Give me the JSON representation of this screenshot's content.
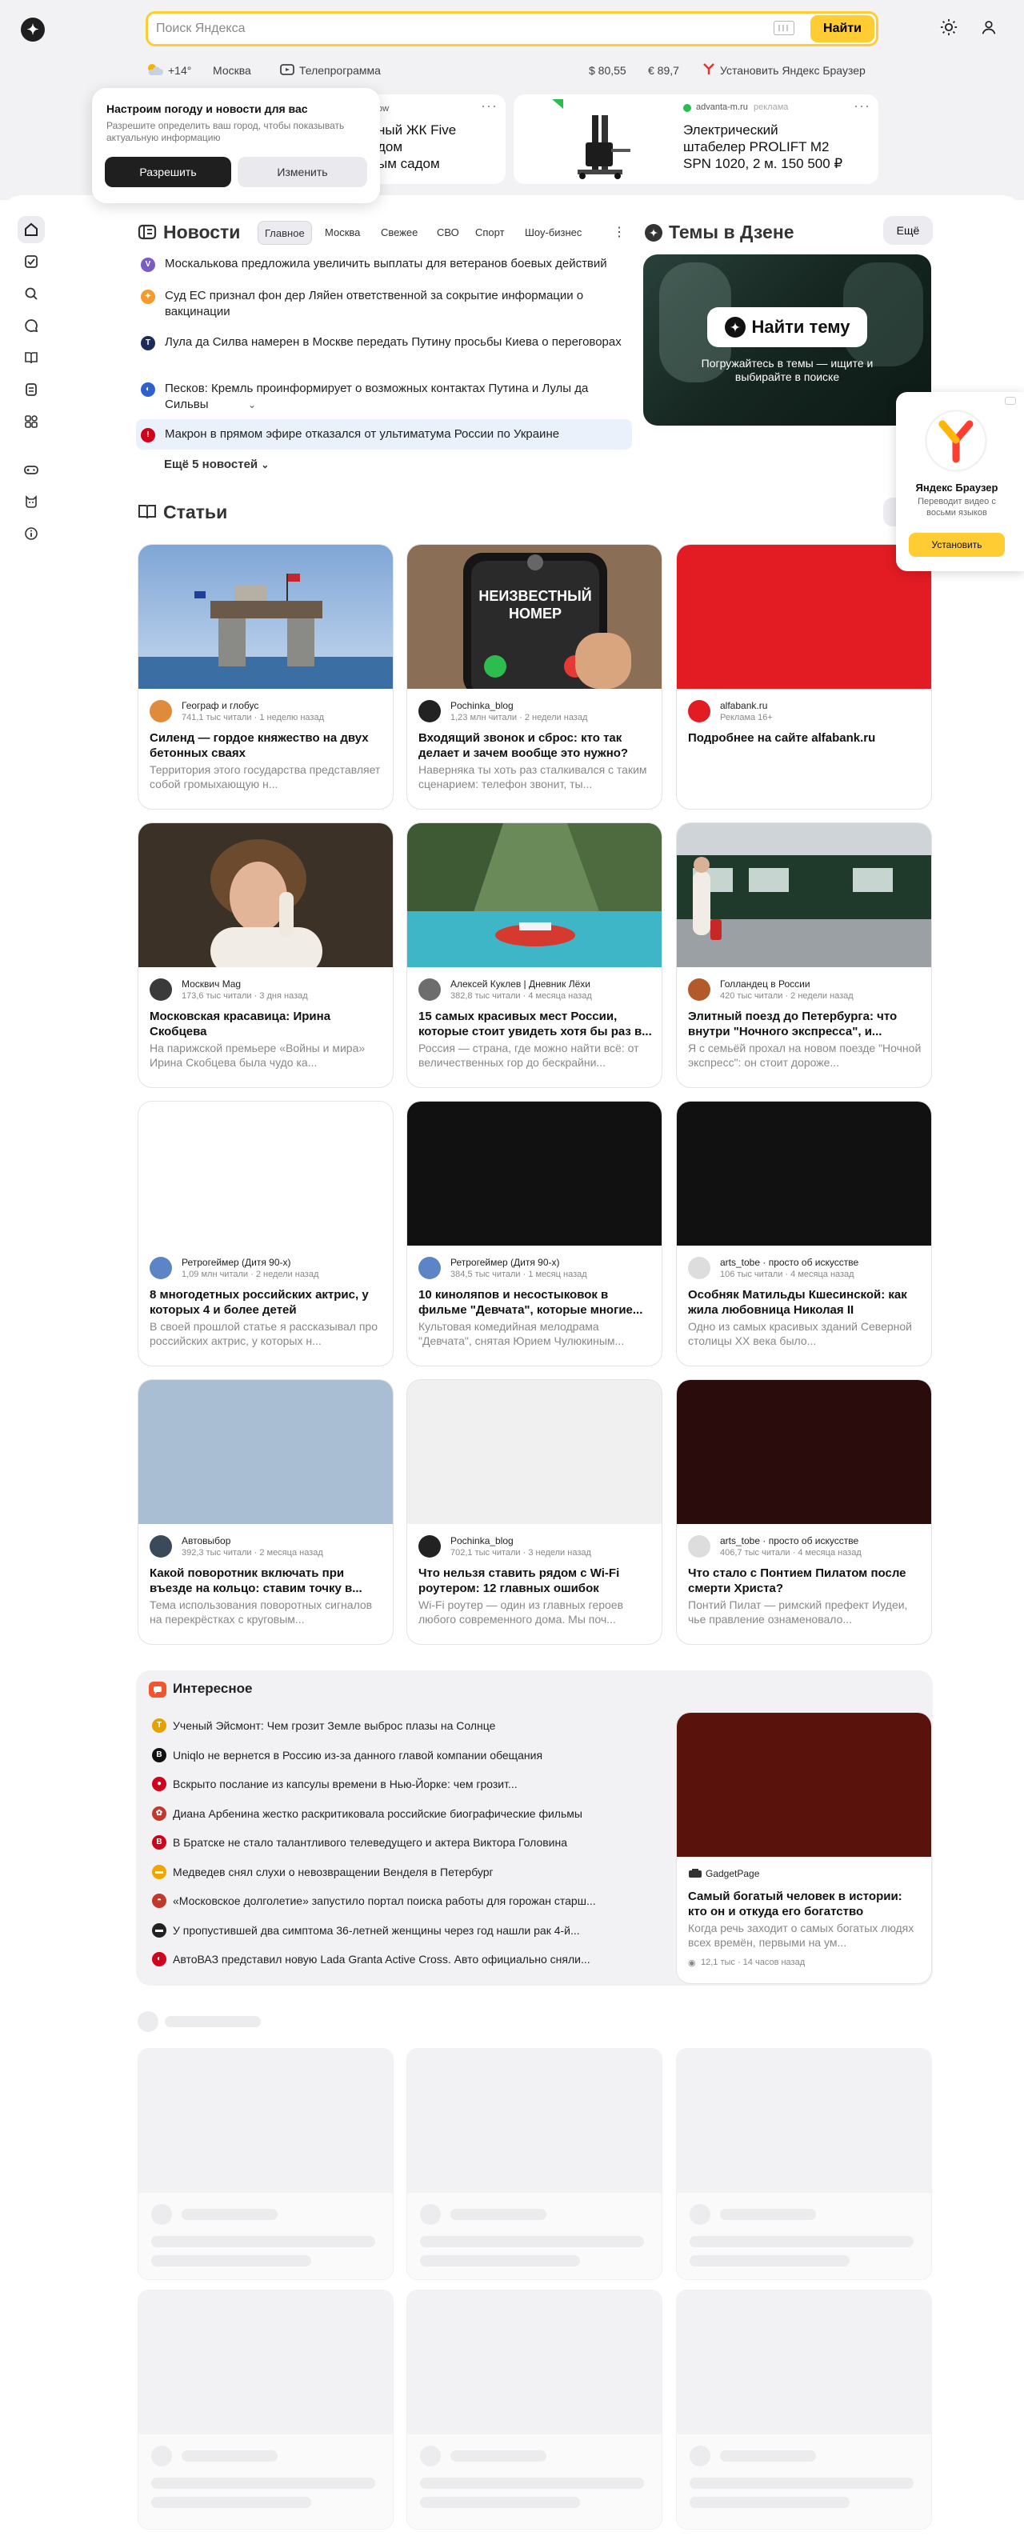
{
  "header": {
    "logo": "✦",
    "search_placeholder": "Поиск Яндекса",
    "search_button": "Найти",
    "icons": [
      "theme-sun-icon",
      "profile-icon"
    ]
  },
  "infobar": {
    "weather_temp": "+14°",
    "city": "Москва",
    "tv": "Телепрограмма",
    "usd": "$ 80,55",
    "eur": "€ 89,7",
    "install_browser": "Установить Яндекс Браузер"
  },
  "popup": {
    "title": "Настроим погоду и новости для вас",
    "desc": "Разрешите определить ваш город, чтобы показывать актуальную информацию",
    "allow": "Разрешить",
    "change": "Изменить"
  },
  "ads": [
    {
      "source": "ow",
      "title": "ный ЖК Five\nдом\nым садом",
      "more": "···"
    },
    {
      "source": "advanta-m.ru",
      "tag": "реклама",
      "title": "Электрический штабелер PROLIFT M2 SPN 1020, 2 м. 150 500 ₽",
      "more": "···"
    }
  ],
  "news": {
    "title": "Новости",
    "tabs": [
      "Главное",
      "Москва",
      "Свежее",
      "СВО",
      "Спорт",
      "Шоу-бизнес"
    ],
    "tabs_more": "⋮",
    "items": [
      {
        "text": "Москалькова предложила увеличить выплаты для ветеранов боевых действий",
        "color": "#7b5cc4",
        "glyph": "V"
      },
      {
        "text": "Суд ЕС признал фон дер Ляйен ответственной за сокрытие информации о вакцинации",
        "color": "#f59b2b",
        "glyph": "✦"
      },
      {
        "text": "Лула да Силва намерен в Москве передать Путину просьбы Киева о переговорах",
        "color": "#1d2a5c",
        "glyph": "Т"
      },
      {
        "text": "Песков: Кремль проинформирует о возможных контактах Путина и Лулы да Сильвы",
        "color": "#2f5fd0",
        "glyph": "◐"
      },
      {
        "text": "Макрон в прямом эфире отказался от ультиматума России по Украине",
        "color": "#d0021b",
        "glyph": "!"
      }
    ],
    "more": "Ещё 5 новостей"
  },
  "dzen": {
    "title": "Темы в Дзене",
    "more": "Ещё",
    "button": "Найти тему",
    "subtitle": "Погружайтесь в темы — ищите и выбирайте в поиске"
  },
  "promo": {
    "title": "Яндекс Браузер",
    "desc": "Переводит видео с восьми языков",
    "button": "Установить"
  },
  "articles": {
    "title": "Статьи",
    "cards": [
      {
        "author": "Географ и глобус",
        "meta": "741,1 тыс читали · 1 неделю назад",
        "title": "Силенд — гордое княжество на двух бетонных сваях",
        "excerpt": "Территория этого государства представляет собой громыхающую н...",
        "img": "sea"
      },
      {
        "author": "Pochinka_blog",
        "meta": "1,23 млн читали · 2 недели назад",
        "title": "Входящий звонок и сброс: кто так делает и зачем вообще это нужно?",
        "excerpt": "Наверняка ты хоть раз сталкивался с таким сценарием: телефон звонит, ты...",
        "img": "phone"
      },
      {
        "author": "alfabank.ru",
        "meta": "Реклама 16+",
        "title": "Подробнее на сайте alfabank.ru",
        "excerpt": "",
        "img": "red"
      },
      {
        "author": "Москвич Mag",
        "meta": "173,6 тыс читали · 3 дня назад",
        "title": "Московская красавица: Ирина Скобцева",
        "excerpt": "На парижской премьере «Войны и мира» Ирина Скобцева была чудо ка...",
        "img": "portrait"
      },
      {
        "author": "Алексей Куклев | Дневник Лёхи",
        "meta": "382,8 тыс читали · 4 месяца назад",
        "title": "15 самых красивых мест России, которые стоит увидеть хотя бы раз в...",
        "excerpt": "Россия — страна, где можно найти всё: от величественных гор до бескрайни...",
        "img": "river"
      },
      {
        "author": "Голландец в России",
        "meta": "420 тыс читали · 2 недели назад",
        "title": "Элитный поезд до Петербурга: что внутри \"Ночного экспресса\", и...",
        "excerpt": "Я с семьёй прохал на новом поезде \"Ночной экспресс\": он стоит дороже...",
        "img": "train"
      },
      {
        "author": "Ретрогеймер (Дитя 90-х)",
        "meta": "1,09 млн читали · 2 недели назад",
        "title": "8 многодетных российских актрис, у которых 4 и более детей",
        "excerpt": "В своей прошлой статье я рассказывал про российских актрис, у которых н...",
        "img": "white"
      },
      {
        "author": "Ретрогеймер (Дитя 90-х)",
        "meta": "384,5 тыс читали · 1 месяц назад",
        "title": "10 киноляпов и несостыковок в фильме \"Девчата\", которые многие...",
        "excerpt": "Культовая комедийная мелодрама \"Девчата\", снятая Юрием Чулюкиным...",
        "img": "black"
      },
      {
        "author": "arts_tobe · просто об искусстве",
        "meta": "106 тыс читали · 4 месяца назад",
        "title": "Особняк Матильды Кшесинской: как жила любовница Николая II",
        "excerpt": "Одно из самых красивых зданий Северной столицы XX века было...",
        "img": "black"
      },
      {
        "author": "Автовыбор",
        "meta": "392,3 тыс читали · 2 месяца назад",
        "title": "Какой поворотник включать при въезде на кольцо: ставим точку в...",
        "excerpt": "Тема использования поворотных сигналов на перекрёстках с круговым...",
        "img": "blue"
      },
      {
        "author": "Pochinka_blog",
        "meta": "702,1 тыс читали · 3 недели назад",
        "title": "Что нельзя ставить рядом с Wi-Fi роутером: 12 главных ошибок",
        "excerpt": "Wi-Fi роутер — один из главных героев любого современного дома. Мы поч...",
        "img": "lightgray"
      },
      {
        "author": "arts_tobe · просто об искусстве",
        "meta": "406,7 тыс читали · 4 месяца назад",
        "title": "Что стало с Понтием Пилатом после смерти Христа?",
        "excerpt": "Понтий Пилат — римский префект Иудеи, чье правление ознаменовало...",
        "img": "darkred"
      }
    ]
  },
  "interesting": {
    "title": "Интересное",
    "items": [
      {
        "text": "Ученый Эйсмонт: Чем грозит Земле выброс плазы на Солнце",
        "color": "#e5a100",
        "glyph": "Т"
      },
      {
        "text": "Uniqlo не вернется в Россию из-за данного главой компании обещания",
        "color": "#111111",
        "glyph": "B"
      },
      {
        "text": "Вскрыто послание из капсулы времени в Нью-Йорке: чем грозит...",
        "color": "#d0021b",
        "glyph": "●"
      },
      {
        "text": "Диана Арбенина жестко раскритиковала российские биографические фильмы",
        "color": "#c0392b",
        "glyph": "✿"
      },
      {
        "text": "В Братске не стало талантливого телеведущего и актера Виктора Головина",
        "color": "#d0021b",
        "glyph": "B"
      },
      {
        "text": "Медведев снял слухи о невозвращении Венделя в Петербург",
        "color": "#f0a500",
        "glyph": "▬"
      },
      {
        "text": "«Московское долголетие» запустило портал поиска работы для горожан старш...",
        "color": "#c0392b",
        "glyph": "◓"
      },
      {
        "text": "У пропустившей два симптома 36-летней женщины через год нашли рак 4-й...",
        "color": "#222222",
        "glyph": "▬"
      },
      {
        "text": "АвтоВАЗ представил новую Lada Granta Active Cross. Авто официально сняли...",
        "color": "#d0021b",
        "glyph": "◐"
      }
    ],
    "card": {
      "author": "GadgetPage",
      "title": "Самый богатый человек в истории: кто он и откуда его богатство",
      "excerpt": "Когда речь заходит о самых богатых людях всех времён, первыми на ум...",
      "meta": "12,1 тыс · 14 часов назад"
    }
  },
  "colors": {
    "accent": "#ffcc33",
    "brand_red": "#d0021b"
  }
}
